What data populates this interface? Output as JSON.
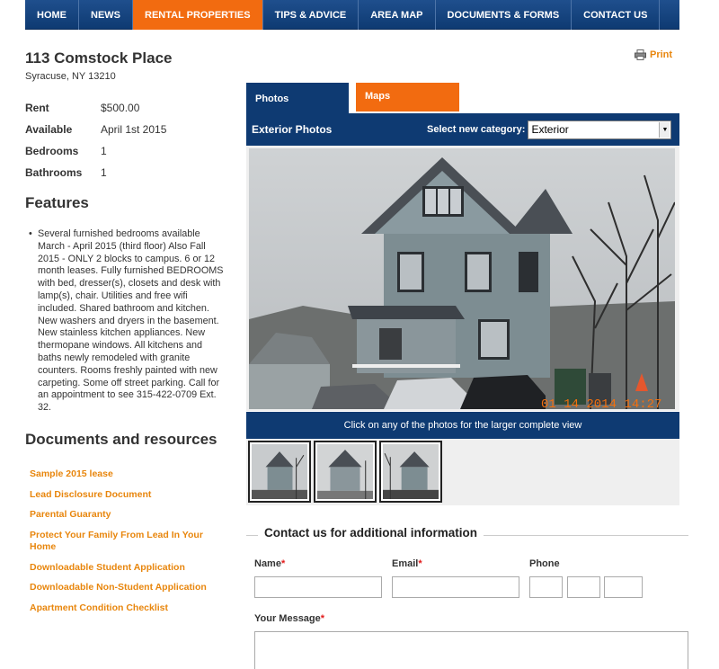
{
  "nav": {
    "items": [
      {
        "label": "HOME"
      },
      {
        "label": "NEWS"
      },
      {
        "label": "RENTAL PROPERTIES"
      },
      {
        "label": "TIPS & ADVICE"
      },
      {
        "label": "AREA MAP"
      },
      {
        "label": "DOCUMENTS & FORMS"
      },
      {
        "label": "CONTACT US"
      }
    ],
    "active_index": 2
  },
  "property": {
    "title": "113 Comstock Place",
    "address": "Syracuse, NY 13210",
    "facts": [
      {
        "label": "Rent",
        "value": "$500.00"
      },
      {
        "label": "Available",
        "value": "April 1st 2015"
      },
      {
        "label": "Bedrooms",
        "value": "1"
      },
      {
        "label": "Bathrooms",
        "value": "1"
      }
    ]
  },
  "features": {
    "heading": "Features",
    "items": [
      "Several furnished bedrooms available March - April 2015 (third floor) Also Fall 2015 - ONLY 2 blocks to campus. 6 or 12 month leases. Fully furnished BEDROOMS with bed, dresser(s), closets and desk with lamp(s), chair. Utilities and free wifi included. Shared bathroom and kitchen. New washers and dryers in the basement. New stainless kitchen appliances. New thermopane windows. All kitchens and baths newly remodeled with granite counters. Rooms freshly painted with new carpeting. Some off street parking. Call for an appointment to see 315-422-0709 Ext. 32."
    ]
  },
  "documents": {
    "heading": "Documents and resources",
    "links": [
      "Sample 2015 lease",
      "Lead Disclosure Document",
      "Parental Guaranty",
      "Protect Your Family From Lead In Your Home",
      "Downloadable Student Application",
      "Downloadable Non-Student Application",
      "Apartment Condition Checklist"
    ]
  },
  "print_label": "Print",
  "tabs": {
    "photos": "Photos",
    "maps": "Maps"
  },
  "gallery": {
    "title": "Exterior Photos",
    "category_label": "Select new category:",
    "category_value": "Exterior",
    "photo_timestamp": "01 14 2014 14:27",
    "hint": "Click on any of the photos for the larger complete view",
    "thumb_count": 3
  },
  "contact": {
    "heading": "Contact us for additional information",
    "name_label": "Name",
    "email_label": "Email",
    "phone_label": "Phone",
    "message_label": "Your Message",
    "required_mark": "*"
  },
  "colors": {
    "nav_blue": "#0e3a72",
    "accent_orange": "#f26b10",
    "link_orange": "#e8860d",
    "required_red": "#e21b1b"
  }
}
